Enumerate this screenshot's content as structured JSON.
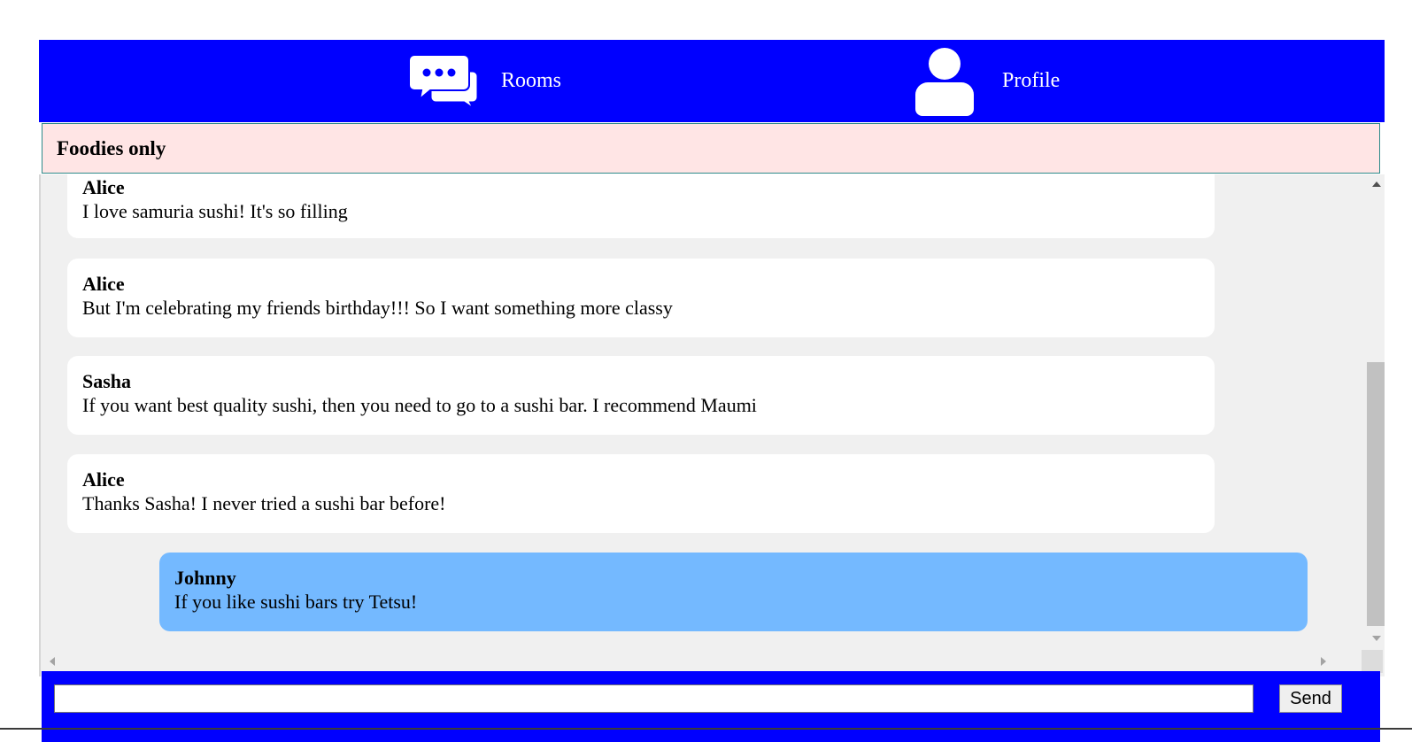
{
  "nav": {
    "rooms_label": "Rooms",
    "profile_label": "Profile",
    "background_color": "#0000ff",
    "icons": [
      "chat-bubbles-icon",
      "user-icon"
    ]
  },
  "room": {
    "title": "Foodies only",
    "header_color": "#ffe5e5"
  },
  "messages": [
    {
      "sender": "Alice",
      "text": "I love samuria sushi! It's so filling",
      "own": false
    },
    {
      "sender": "Alice",
      "text": "But I'm celebrating my friends birthday!!! So I want something more classy",
      "own": false
    },
    {
      "sender": "Sasha",
      "text": "If you want best quality sushi, then you need to go to a sushi bar. I recommend Maumi",
      "own": false
    },
    {
      "sender": "Alice",
      "text": "Thanks Sasha! I never tried a sushi bar before!",
      "own": false
    },
    {
      "sender": "Johnny",
      "text": "If you like sushi bars try Tetsu!",
      "own": true
    }
  ],
  "colors": {
    "own_message": "#74b9ff",
    "other_message": "#ffffff",
    "messages_background": "#f0f0f0"
  },
  "composer": {
    "input_value": "",
    "input_placeholder": "",
    "send_label": "Send"
  }
}
